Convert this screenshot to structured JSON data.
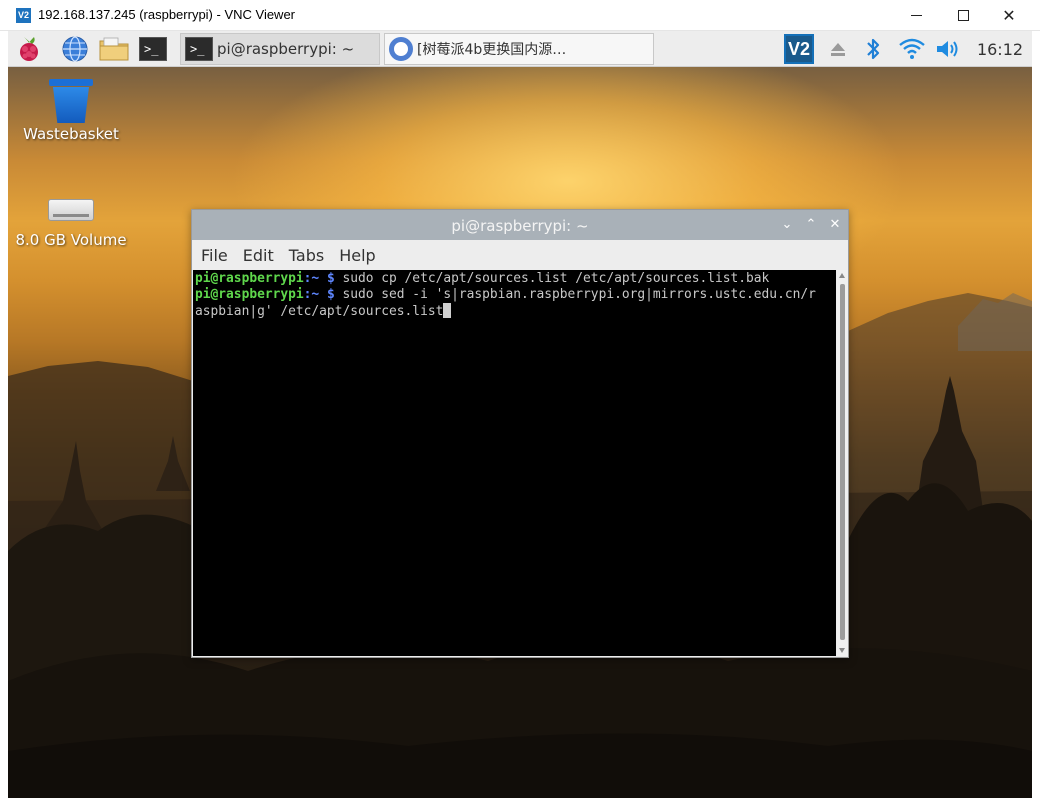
{
  "vnc_window": {
    "app_icon_text": "V2",
    "title": "192.168.137.245 (raspberrypi) - VNC Viewer"
  },
  "panel": {
    "taskbar_items": [
      {
        "label": "pi@raspberrypi: ~",
        "icon": "terminal-icon"
      },
      {
        "label": "[树莓派4b更换国内源…",
        "icon": "chromium-icon"
      }
    ],
    "launcher_icons": [
      "raspberry-pi-menu-icon",
      "web-browser-icon",
      "file-manager-icon",
      "terminal-icon"
    ],
    "tray": {
      "vnc_logo_text": "V2",
      "clock": "16:12"
    }
  },
  "desktop": {
    "icons": [
      {
        "label": "Wastebasket",
        "icon": "trash-icon"
      },
      {
        "label": "8.0 GB Volume",
        "icon": "drive-icon"
      }
    ]
  },
  "terminal": {
    "title": "pi@raspberrypi: ~",
    "menu": [
      "File",
      "Edit",
      "Tabs",
      "Help"
    ],
    "lines": [
      {
        "user": "pi@raspberrypi",
        "path": ":~ $",
        "command": " sudo cp /etc/apt/sources.list /etc/apt/sources.list.bak"
      },
      {
        "user": "pi@raspberrypi",
        "path": ":~ $",
        "command": " sudo sed -i 's|raspbian.raspberrypi.org|mirrors.ustc.edu.cn/r"
      },
      {
        "user": "",
        "path": "",
        "command": "aspbian|g' /etc/apt/sources.list"
      }
    ]
  },
  "colors": {
    "prompt_user": "#5fd74c",
    "prompt_path": "#5f87ff",
    "terminal_titlebar": "#a9b1b8"
  }
}
